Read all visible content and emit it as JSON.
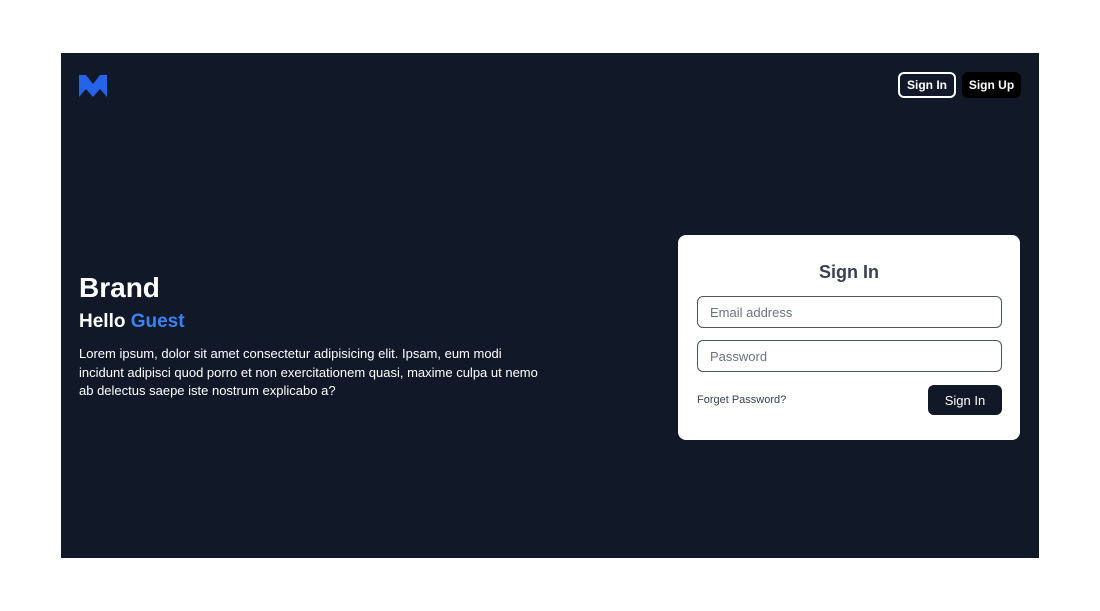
{
  "header": {
    "logo_icon": "m-logo-icon",
    "logo_color": "#2563eb",
    "signin_label": "Sign In",
    "signup_label": "Sign Up"
  },
  "hero": {
    "title": "Brand",
    "greeting": "Hello",
    "greeting_name": "Guest",
    "accent_color": "#3b82f6",
    "body": "Lorem ipsum, dolor sit amet consectetur adipisicing elit. Ipsam, eum modi incidunt adipisci quod porro et non exercitationem quasi, maxime culpa ut nemo ab delectus saepe iste nostrum explicabo a?"
  },
  "signin_card": {
    "title": "Sign In",
    "email_placeholder": "Email address",
    "password_placeholder": "Password",
    "forget_label": "Forget Password?",
    "submit_label": "Sign In"
  },
  "colors": {
    "background": "#111827",
    "card": "#ffffff"
  }
}
